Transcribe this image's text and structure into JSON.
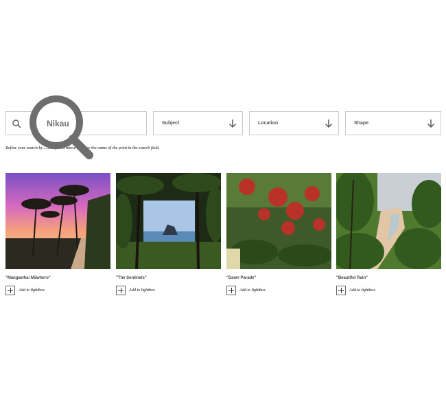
{
  "search": {
    "placeholder": "",
    "query": "Nikau",
    "icon": "search-icon"
  },
  "filters": [
    {
      "label": "Subject",
      "icon": "arrow-down-icon"
    },
    {
      "label": "Location",
      "icon": "arrow-down-icon"
    },
    {
      "label": "Shape",
      "icon": "arrow-down-icon"
    }
  ],
  "hint": "Refine your search by ... categories above or enter the name of the print in the search field.",
  "prints": [
    {
      "title": "\"Mangawhai Māwhero\"",
      "action": "Add to lightbox"
    },
    {
      "title": "\"The Sentinels\"",
      "action": "Add to lightbox"
    },
    {
      "title": "\"Dawn Parade\"",
      "action": "Add to lightbox"
    },
    {
      "title": "\"Beautiful Rain\"",
      "action": "Add to lightbox"
    }
  ],
  "colors": {
    "border": "#c9c9c9",
    "icon_grey": "#6e6e6e"
  }
}
